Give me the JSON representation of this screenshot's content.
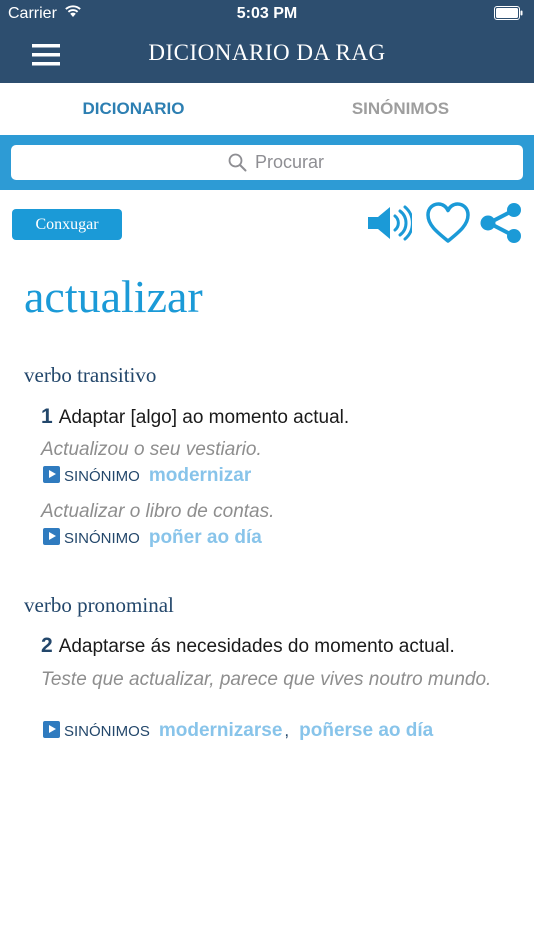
{
  "status": {
    "carrier": "Carrier",
    "time": "5:03 PM"
  },
  "nav": {
    "title": "DICIONARIO DA RAG"
  },
  "tabs": [
    {
      "label": "DICIONARIO",
      "active": true
    },
    {
      "label": "SINÓNIMOS",
      "active": false
    }
  ],
  "search": {
    "placeholder": "Procurar",
    "value": ""
  },
  "toolbar": {
    "conjugate_label": "Conxugar"
  },
  "entry": {
    "headword": "actualizar",
    "groups": [
      {
        "pos": "verbo transitivo",
        "senses": [
          {
            "number": "1",
            "definition": "Adaptar [algo] ao momento actual.",
            "examples": [
              {
                "text": "Actualizou o seu vestiario.",
                "syn_label": "SINÓNIMO",
                "synonyms": [
                  "modernizar"
                ]
              },
              {
                "text": "Actualizar o libro de contas.",
                "syn_label": "SINÓNIMO",
                "synonyms": [
                  "poñer ao día"
                ]
              }
            ]
          }
        ]
      },
      {
        "pos": "verbo pronominal",
        "senses": [
          {
            "number": "2",
            "definition": "Adaptarse ás necesidades do momento actual.",
            "examples": [
              {
                "text": "Teste que actualizar, parece que vives noutro mundo.",
                "syn_label": "SINÓNIMOS",
                "synonyms": [
                  "modernizarse",
                  "poñerse ao día"
                ],
                "separator": ","
              }
            ]
          }
        ]
      }
    ]
  },
  "colors": {
    "header": "#2d4e6f",
    "accent": "#1b9ad7",
    "synonym": "#88c4ea"
  }
}
